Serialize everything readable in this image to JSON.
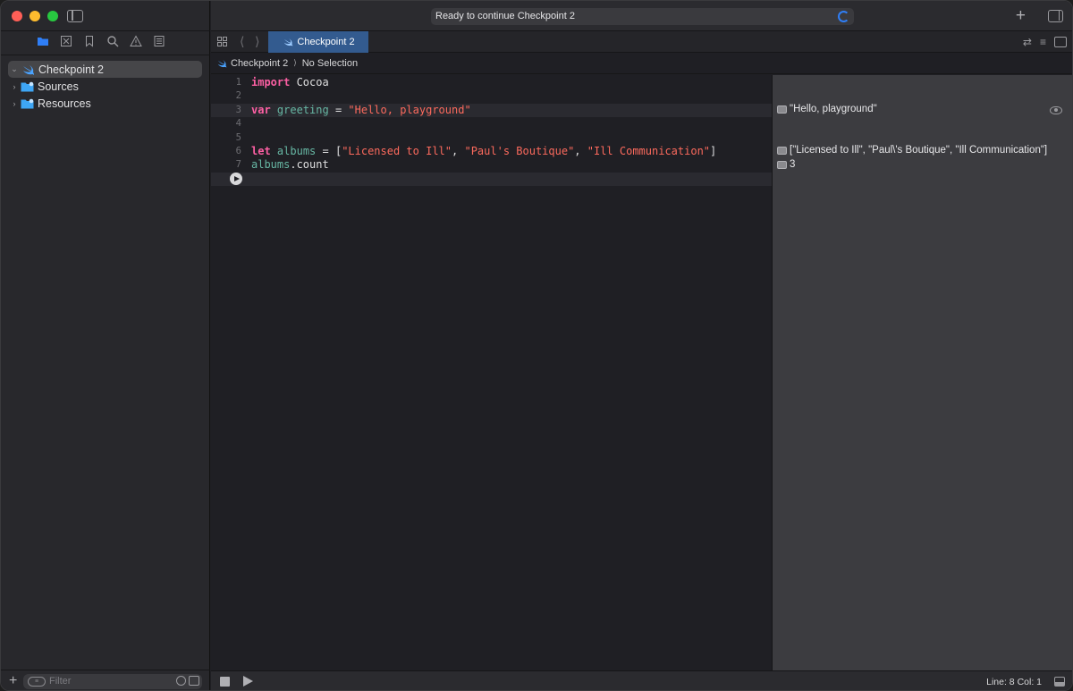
{
  "toolbar": {
    "activity_status": "Ready to continue Checkpoint 2"
  },
  "navigator": {
    "tree": [
      {
        "label": "Checkpoint 2",
        "icon": "swift-icon"
      },
      {
        "label": "Sources",
        "icon": "folder-icon"
      },
      {
        "label": "Resources",
        "icon": "folder-icon"
      }
    ],
    "filter_placeholder": "Filter"
  },
  "editor": {
    "tab_label": "Checkpoint 2",
    "breadcrumb": {
      "file": "Checkpoint 2",
      "selection": "No Selection"
    },
    "lines": [
      {
        "num": "1",
        "tokens": [
          [
            "kw",
            "import"
          ],
          [
            "plain",
            " Cocoa"
          ]
        ]
      },
      {
        "num": "2",
        "tokens": []
      },
      {
        "num": "3",
        "tokens": [
          [
            "kw",
            "var"
          ],
          [
            "plain",
            " "
          ],
          [
            "var",
            "greeting"
          ],
          [
            "plain",
            " = "
          ],
          [
            "str",
            "\"Hello, playground\""
          ]
        ]
      },
      {
        "num": "4",
        "tokens": []
      },
      {
        "num": "5",
        "tokens": []
      },
      {
        "num": "6",
        "tokens": [
          [
            "kw",
            "let"
          ],
          [
            "plain",
            " "
          ],
          [
            "var",
            "albums"
          ],
          [
            "plain",
            " = ["
          ],
          [
            "str",
            "\"Licensed to Ill\""
          ],
          [
            "plain",
            ", "
          ],
          [
            "str",
            "\"Paul's Boutique\""
          ],
          [
            "plain",
            ", "
          ],
          [
            "str",
            "\"Ill Communication\""
          ],
          [
            "plain",
            "]"
          ]
        ]
      },
      {
        "num": "7",
        "tokens": [
          [
            "var",
            "albums"
          ],
          [
            "plain",
            ".count"
          ]
        ]
      },
      {
        "num": "",
        "tokens": []
      }
    ]
  },
  "results": {
    "greeting": "\"Hello, playground\"",
    "albums": "[\"Licensed to Ill\", \"Paul\\'s Boutique\", \"Ill Communication\"]",
    "count": "3"
  },
  "status": {
    "position": "Line: 8  Col: 1"
  },
  "colors": {
    "keyword": "#fc5fa3",
    "variable": "#67b7a4",
    "string": "#fc6a5d",
    "tab_active": "#335b8f"
  }
}
